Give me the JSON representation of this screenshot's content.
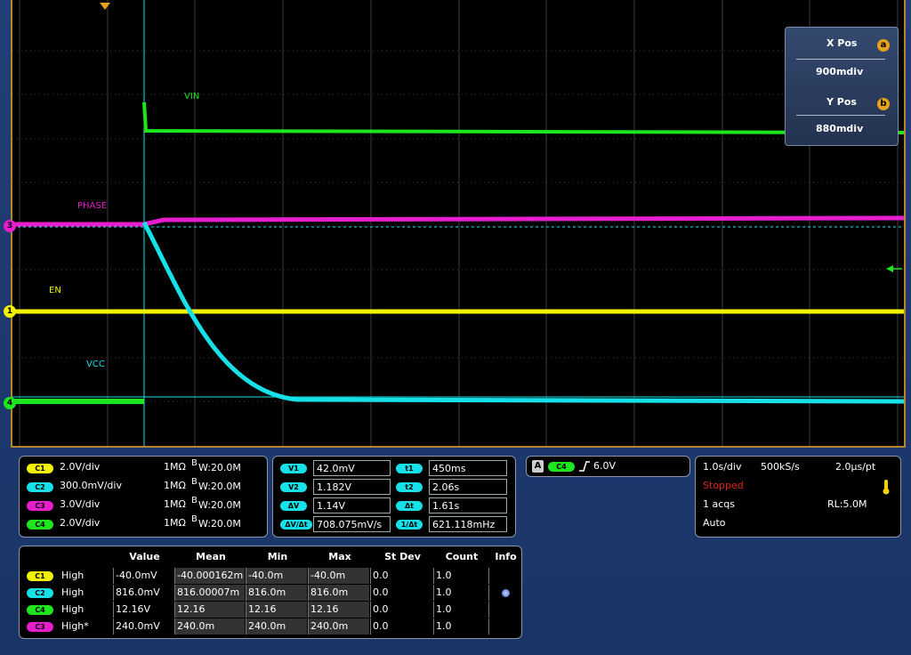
{
  "colors": {
    "ch1": "#f2f200",
    "ch2": "#16e0e8",
    "ch3": "#e61ecd",
    "ch4": "#1ee61e",
    "grid": "#3b3b3b",
    "frame": "#b5852e"
  },
  "traces": {
    "vin": "VIN",
    "phase": "PHASE",
    "en": "EN",
    "vcc": "VCC"
  },
  "markers": {
    "m3": "3",
    "m1": "1",
    "m4": "4"
  },
  "position_box": {
    "xpos_label": "X Pos",
    "xpos_value": "900mdiv",
    "ypos_label": "Y Pos",
    "ypos_value": "880mdiv",
    "a_badge": "a",
    "b_badge": "b"
  },
  "channels": [
    {
      "tag": "C1",
      "scale": "2.0V/div",
      "imp": "1MΩ",
      "bw_b": "B",
      "bw_rest": "W:20.0M"
    },
    {
      "tag": "C2",
      "scale": "300.0mV/div",
      "imp": "1MΩ",
      "bw_b": "B",
      "bw_rest": "W:20.0M"
    },
    {
      "tag": "C3",
      "scale": "3.0V/div",
      "imp": "1MΩ",
      "bw_b": "B",
      "bw_rest": "W:20.0M"
    },
    {
      "tag": "C4",
      "scale": "2.0V/div",
      "imp": "1MΩ",
      "bw_b": "B",
      "bw_rest": "W:20.0M"
    }
  ],
  "cursors": {
    "v1_label": "V1",
    "v1": "42.0mV",
    "v2_label": "V2",
    "v2": "1.182V",
    "dv_label": "ΔV",
    "dv": "1.14V",
    "dvdt_label": "ΔV/Δt",
    "dvdt": "708.075mV/s",
    "t1_label": "t1",
    "t1": "450ms",
    "t2_label": "t2",
    "t2": "2.06s",
    "dt_label": "Δt",
    "dt": "1.61s",
    "inv_label": "1/Δt",
    "inv": "621.118mHz"
  },
  "trigger": {
    "mode": "A",
    "source": "C4",
    "level": "6.0V"
  },
  "acquisition": {
    "timebase": "1.0s/div",
    "sample_rate": "500kS/s",
    "resolution": "2.0µs/pt",
    "state": "Stopped",
    "acqs": "1 acqs",
    "record_length": "RL:5.0M",
    "mode": "Auto"
  },
  "measurements": {
    "headers": [
      "Value",
      "Mean",
      "Min",
      "Max",
      "St Dev",
      "Count",
      "Info"
    ],
    "rows": [
      {
        "tag": "C1",
        "name": "High",
        "value": "-40.0mV",
        "mean": "-40.000162m",
        "min": "-40.0m",
        "max": "-40.0m",
        "stdev": "0.0",
        "count": "1.0"
      },
      {
        "tag": "C2",
        "name": "High",
        "value": "816.0mV",
        "mean": "816.00007m",
        "min": "816.0m",
        "max": "816.0m",
        "stdev": "0.0",
        "count": "1.0"
      },
      {
        "tag": "C4",
        "name": "High",
        "value": "12.16V",
        "mean": "12.16",
        "min": "12.16",
        "max": "12.16",
        "stdev": "0.0",
        "count": "1.0"
      },
      {
        "tag": "C3",
        "name": "High*",
        "value": "240.0mV",
        "mean": "240.0m",
        "min": "240.0m",
        "max": "240.0m",
        "stdev": "0.0",
        "count": "1.0"
      }
    ]
  }
}
